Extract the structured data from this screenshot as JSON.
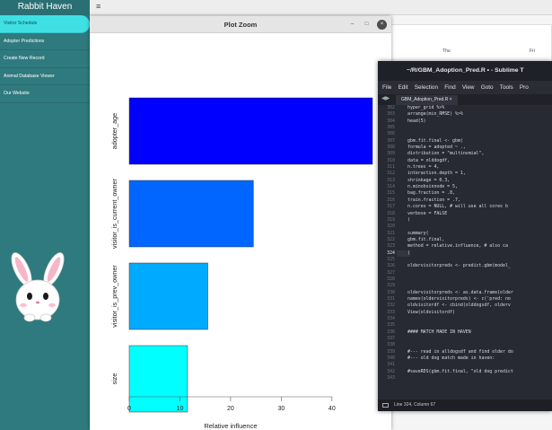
{
  "app": {
    "brand": "Rabbit Haven",
    "nav": [
      {
        "label": "Visitor Schedule",
        "active": true
      },
      {
        "label": "Adopter Predictions",
        "active": false
      },
      {
        "label": "Create New Record",
        "active": false
      },
      {
        "label": "Animal Database Viewer",
        "active": false
      },
      {
        "label": "Our Website",
        "active": false
      }
    ],
    "menu_icon": "hamburger-icon",
    "calendar_days": [
      "Thu",
      "Fri"
    ]
  },
  "zoom": {
    "title": "Plot Zoom",
    "minimize_icon": "minimize-icon",
    "maximize_icon": "maximize-icon",
    "close_icon": "close-icon"
  },
  "chart_data": {
    "type": "bar",
    "orientation": "horizontal",
    "categories": [
      "adopter_age",
      "visitor_is_current_owner",
      "visitor_is_prev_owner",
      "size"
    ],
    "values": [
      48,
      24.5,
      15.5,
      11.5
    ],
    "colors": [
      "#0000ff",
      "#0066ff",
      "#00aaff",
      "#00ffff"
    ],
    "xlabel": "Relative influence",
    "xticks": [
      0,
      10,
      20,
      30,
      40
    ],
    "xlim": [
      0,
      48
    ],
    "grid": false
  },
  "sublime": {
    "title": "~/R/GBM_Adoption_Pred.R • - Sublime T",
    "menu": [
      "File",
      "Edit",
      "Selection",
      "Find",
      "View",
      "Goto",
      "Tools",
      "Pro"
    ],
    "tab": "GBM_Adoption_Pred.R",
    "current_line": 324,
    "lines": [
      {
        "n": 302,
        "t": "hyper_grid %>%"
      },
      {
        "n": 303,
        "t": "  arrange(min_RMSE) %>%"
      },
      {
        "n": 304,
        "t": "  head(5)"
      },
      {
        "n": 305,
        "t": ""
      },
      {
        "n": 306,
        "t": ""
      },
      {
        "n": 307,
        "t": "gbm.fit.final <- gbm("
      },
      {
        "n": 308,
        "t": "  formula = adopted ~ .,"
      },
      {
        "n": 309,
        "t": "  distribution = \"multinomial\","
      },
      {
        "n": 310,
        "t": "  data = olddogdf,"
      },
      {
        "n": 311,
        "t": "  n.trees = 4,"
      },
      {
        "n": 312,
        "t": "  interaction.depth = 1,"
      },
      {
        "n": 313,
        "t": "  shrinkage = 0.3,"
      },
      {
        "n": 314,
        "t": "  n.minobsinnode = 5,"
      },
      {
        "n": 315,
        "t": "  bag.fraction = .8,"
      },
      {
        "n": 316,
        "t": "  train.fraction = .7,"
      },
      {
        "n": 317,
        "t": "  n.cores = NULL, # will use all cores b"
      },
      {
        "n": 318,
        "t": "  verbose = FALSE"
      },
      {
        "n": 319,
        "t": ")"
      },
      {
        "n": 320,
        "t": ""
      },
      {
        "n": 321,
        "t": "summary("
      },
      {
        "n": 322,
        "t": "  gbm.fit.final,"
      },
      {
        "n": 323,
        "t": "  method = relative.influence, # also ca"
      },
      {
        "n": 324,
        "t": ")"
      },
      {
        "n": 325,
        "t": ""
      },
      {
        "n": 326,
        "t": "oldervisitorpreds  <- predict.gbm(model_"
      },
      {
        "n": 327,
        "t": ""
      },
      {
        "n": 328,
        "t": ""
      },
      {
        "n": 329,
        "t": ""
      },
      {
        "n": 330,
        "t": "oldervisitorpreds <- as.data.frame(older"
      },
      {
        "n": 331,
        "t": "names(oldervisitorpreds) <- c('pred: no "
      },
      {
        "n": 332,
        "t": "oldvisitordf <- cbind(olddogsdf, olderv"
      },
      {
        "n": 333,
        "t": "View(oldvisitordf)"
      },
      {
        "n": 334,
        "t": ""
      },
      {
        "n": 335,
        "t": ""
      },
      {
        "n": 336,
        "t": "#### MATCH MADE IN HAVEN"
      },
      {
        "n": 337,
        "t": ""
      },
      {
        "n": 338,
        "t": ""
      },
      {
        "n": 339,
        "t": "#--- read in alldogsdf and find older do"
      },
      {
        "n": 340,
        "t": "#--- old dog match made in haven:"
      },
      {
        "n": 341,
        "t": ""
      },
      {
        "n": 342,
        "t": "#saveRDS(gbm.fit.final, \"old dog predict"
      },
      {
        "n": 343,
        "t": ""
      }
    ],
    "status": "Line 324, Column 67"
  }
}
